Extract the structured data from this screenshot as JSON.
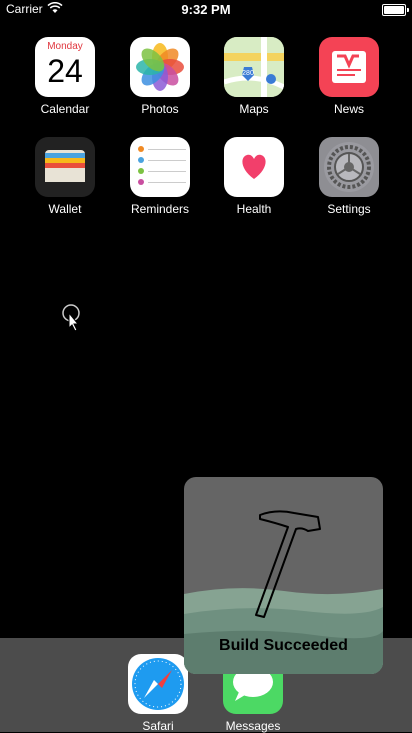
{
  "status_bar": {
    "carrier": "Carrier",
    "time": "9:32 PM",
    "battery_level": 1.0
  },
  "apps": [
    {
      "name": "Calendar",
      "icon": "calendar-icon",
      "day": "Monday",
      "date": "24"
    },
    {
      "name": "Photos",
      "icon": "photos-icon"
    },
    {
      "name": "Maps",
      "icon": "maps-icon",
      "route": "280"
    },
    {
      "name": "News",
      "icon": "news-icon"
    },
    {
      "name": "Wallet",
      "icon": "wallet-icon"
    },
    {
      "name": "Reminders",
      "icon": "reminders-icon"
    },
    {
      "name": "Health",
      "icon": "health-icon"
    },
    {
      "name": "Settings",
      "icon": "settings-icon"
    }
  ],
  "dock": [
    {
      "name": "Safari",
      "icon": "safari-icon"
    },
    {
      "name": "Messages",
      "icon": "messages-icon"
    }
  ],
  "hud": {
    "message": "Build Succeeded",
    "icon": "hammer-icon"
  },
  "colors": {
    "background": "#000000",
    "dock": "#4c4c4c",
    "calendar_red": "#e0373f",
    "news_red": "#f44355",
    "messages_green": "#4cd964"
  }
}
